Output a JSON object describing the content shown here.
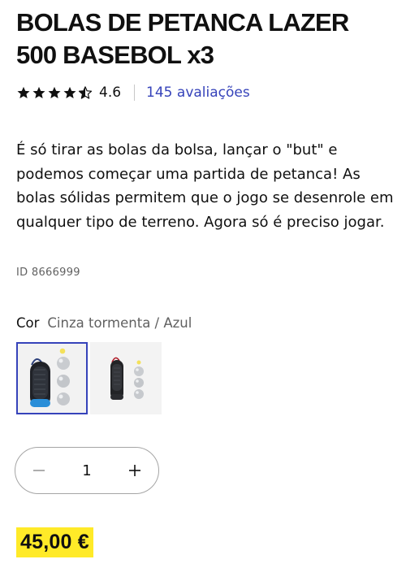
{
  "product": {
    "title": "BOLAS DE PETANCA LAZER 500 BASEBOL x3",
    "rating": "4.6",
    "reviews_text": "145 avaliações",
    "stars_filled": 4.5,
    "description": "É só tirar as bolas da bolsa, lançar o \"but\" e podemos começar uma partida de petanca! As bolas sólidas permitem que o jogo se desenrole em qualquer tipo de terreno. Agora só é preciso jogar.",
    "id_text": "ID 8666999"
  },
  "color": {
    "label": "Cor",
    "selected_value": "Cinza tormenta / Azul"
  },
  "quantity": {
    "value": "1"
  },
  "price": {
    "text": "45,00 €",
    "highlight_color": "#ffea28"
  },
  "colors": {
    "accent": "#3643ba",
    "text": "#101010",
    "muted": "#616161"
  },
  "icons": {
    "star": "star-icon",
    "half_star": "star-half-icon",
    "minus": "minus-icon",
    "plus": "plus-icon"
  }
}
